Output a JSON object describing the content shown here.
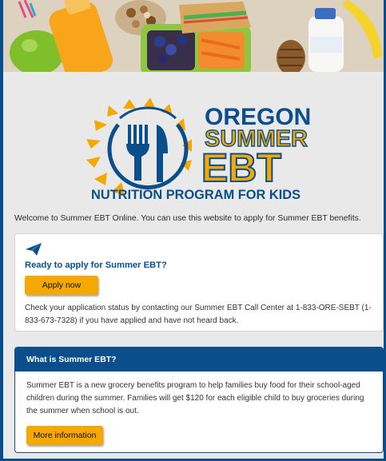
{
  "hero": {
    "name": "healthy-food-banner"
  },
  "logo": {
    "line1": "OREGON",
    "line2": "SUMMER",
    "line3": "EBT",
    "tagline": "NUTRITION PROGRAM FOR KIDS",
    "colors": {
      "blue": "#0a4f8c",
      "gold": "#f5a800"
    }
  },
  "welcome_text": "Welcome to Summer EBT Online. You can use this website to apply for Summer EBT benefits.",
  "apply_card": {
    "icon": "paper-plane-icon",
    "title": "Ready to apply for Summer EBT?",
    "button_label": "Apply now",
    "status_text": "Check your application status by contacting our Summer EBT Call Center at 1-833-ORE-SEBT (1-833-673-7328) if you have applied and have not heard back."
  },
  "info_card": {
    "header": "What is Summer EBT?",
    "body": "Summer EBT is a new grocery benefits program to help families buy food for their school-aged children during the summer. Families will get $120 for each eligible child to buy groceries during the summer when school is out.",
    "button_label": "More information"
  },
  "colors": {
    "accent": "#0a4f8c",
    "button": "#f5a800",
    "background": "#e9e9e9"
  }
}
